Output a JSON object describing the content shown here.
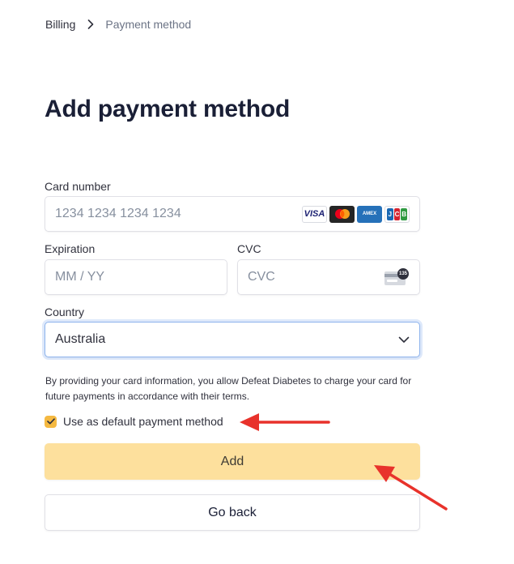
{
  "breadcrumb": {
    "root": "Billing",
    "current": "Payment method"
  },
  "page_title": "Add payment method",
  "card_number": {
    "label": "Card number",
    "placeholder": "1234 1234 1234 1234",
    "brands": [
      "VISA",
      "mastercard",
      "AMEX",
      "JCB"
    ]
  },
  "expiration": {
    "label": "Expiration",
    "placeholder": "MM / YY"
  },
  "cvc": {
    "label": "CVC",
    "placeholder": "CVC",
    "icon_text": "135"
  },
  "country": {
    "label": "Country",
    "selected": "Australia"
  },
  "terms_text": "By providing your card information, you allow Defeat Diabetes to charge your card for future payments in accordance with their terms.",
  "default_checkbox": {
    "label": "Use as default payment method",
    "checked": true
  },
  "buttons": {
    "add": "Add",
    "back": "Go back"
  },
  "colors": {
    "accent": "#f5b941",
    "add_button": "#fde09d",
    "annotation_arrow": "#e8322b",
    "focus_border": "#8eb4ed"
  },
  "icons": {
    "breadcrumb_separator": "chevron-right-icon",
    "select_caret": "chevron-down-icon",
    "checkbox": "check-icon",
    "cvc": "card-back-icon"
  }
}
